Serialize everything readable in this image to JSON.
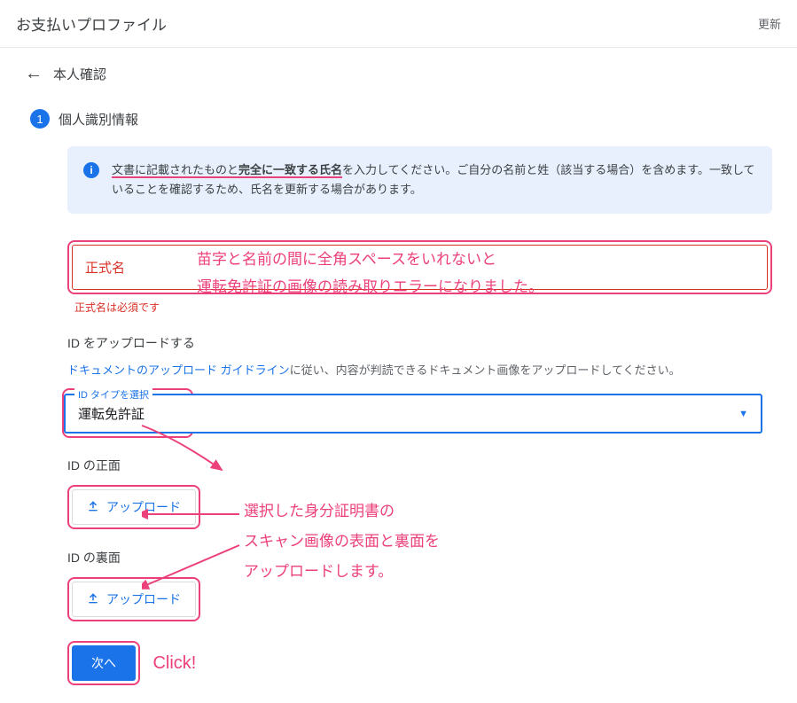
{
  "header": {
    "title": "お支払いプロファイル",
    "update": "更新"
  },
  "breadcrumb": {
    "title": "本人確認"
  },
  "step": {
    "number": "1",
    "title": "個人識別情報"
  },
  "info": {
    "icon": "i",
    "text_prefix": "文書に記載されたものと",
    "text_bold": "完全に一致する氏名",
    "text_suffix": "を入力してください。ご自分の名前と姓（該当する場合）を含めます。一致していることを確認するため、氏名を更新する場合があります。"
  },
  "name_field": {
    "label": "正式名",
    "error": "正式名は必須です"
  },
  "annotation_name": {
    "line1": "苗字と名前の間に全角スペースをいれないと",
    "line2": "運転免許証の画像の読み取りエラーになりました。"
  },
  "upload_section": {
    "heading": "ID をアップロードする",
    "guideline_link": "ドキュメントのアップロード ガイドライン",
    "guideline_suffix": "に従い、内容が判読できるドキュメント画像をアップロードしてください。"
  },
  "select": {
    "legend": "ID タイプを選択",
    "value": "運転免許証"
  },
  "front": {
    "label": "ID の正面",
    "button": "アップロード"
  },
  "back": {
    "label": "ID の裏面",
    "button": "アップロード"
  },
  "annotation_upload": {
    "line1": "選択した身分証明書の",
    "line2": "スキャン画像の表面と裏面を",
    "line3": "アップロードします。"
  },
  "next_button": "次へ",
  "click_label": "Click!"
}
